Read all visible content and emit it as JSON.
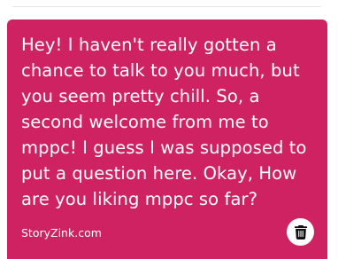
{
  "card": {
    "message": "Hey! I haven't really gotten a chance to talk to you much, but you seem pretty chill. So, a second welcome from me to mppc! I guess I was supposed to put a question here. Okay, How are you liking mppc so far?",
    "watermark": "StoryZink.com",
    "delete_icon": "trash-icon"
  },
  "colors": {
    "card_background": "#cf2262",
    "card_text": "#ffffff",
    "delete_button_background": "#ffffff",
    "delete_icon": "#111111"
  }
}
